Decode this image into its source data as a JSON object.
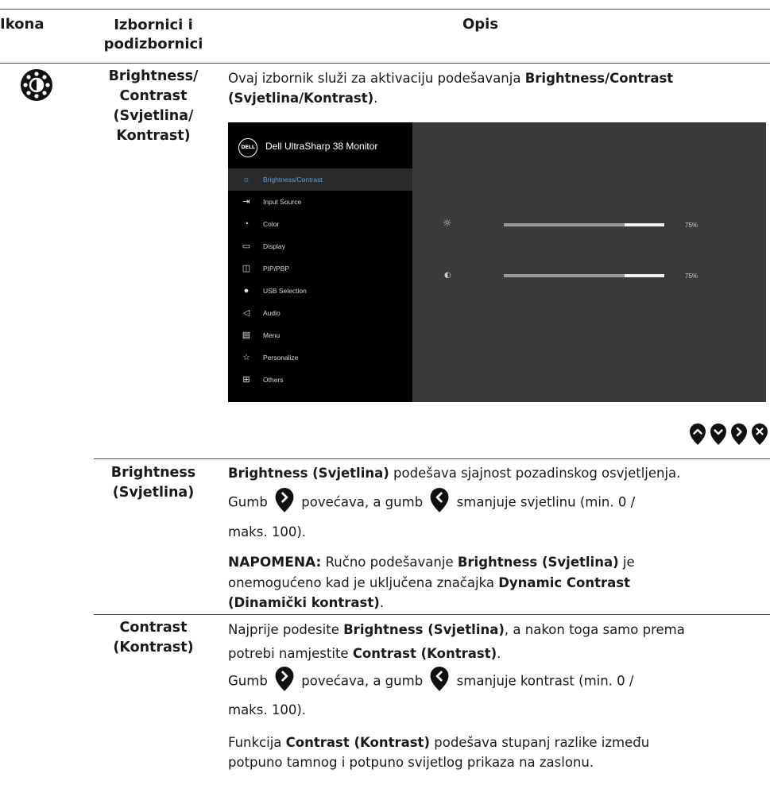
{
  "header": {
    "col_icon": "Ikona",
    "col_menus": "Izbornici i podizbornici",
    "col_desc": "Opis"
  },
  "section": {
    "icon_name": "brightness-contrast-icon",
    "title_line1": "Brightness/",
    "title_line2": "Contrast",
    "title_line3": "(Svjetlina/",
    "title_line4": "Kontrast)",
    "intro_pre": "Ovaj izbornik služi za aktivaciju podešavanja ",
    "intro_bold1": "Brightness/Contrast",
    "intro_bold2": "(Svjetlina/Kontrast)",
    "intro_post": "."
  },
  "osd": {
    "brand": "DELL",
    "title": "Dell UltraSharp 38 Monitor",
    "menu_items": [
      {
        "label": "Brightness/Contrast",
        "icon": "sun-icon"
      },
      {
        "label": "Input Source",
        "icon": "input-icon"
      },
      {
        "label": "Color",
        "icon": "color-icon"
      },
      {
        "label": "Display",
        "icon": "display-icon"
      },
      {
        "label": "PIP/PBP",
        "icon": "pip-icon"
      },
      {
        "label": "USB Selection",
        "icon": "usb-icon"
      },
      {
        "label": "Audio",
        "icon": "audio-icon"
      },
      {
        "label": "Menu",
        "icon": "menu-icon"
      },
      {
        "label": "Personalize",
        "icon": "star-icon"
      },
      {
        "label": "Others",
        "icon": "others-icon"
      }
    ],
    "brightness": {
      "value": 0.75,
      "label": "75%"
    },
    "contrast": {
      "value": 0.75,
      "label": "75%"
    }
  },
  "nav_buttons": [
    "up-icon",
    "down-icon",
    "right-icon",
    "close-icon"
  ],
  "brightness_row": {
    "title_line1": "Brightness",
    "title_line2": "(Svjetlina)",
    "p1_bold": "Brightness (Svjetlina)",
    "p1_rest": " podešava sjajnost pozadinskog osvjetljenja.",
    "p2_a": "Gumb",
    "p2_b": "povećava, a gumb",
    "p2_c": "smanjuje svjetlinu (min. 0 /",
    "p2_d": "maks. 100).",
    "note_label": "NAPOMENA:",
    "note_a": " Ručno podešavanje ",
    "note_bold1": "Brightness (Svjetlina)",
    "note_b": " je",
    "note_c": "onemogućeno kad je uključena značajka ",
    "note_bold2": "Dynamic Contrast",
    "note_bold3": "(Dinamički kontrast)",
    "note_end": "."
  },
  "contrast_row": {
    "title_line1": "Contrast",
    "title_line2": "(Kontrast)",
    "p1_a": "Najprije podesite ",
    "p1_bold1": "Brightness (Svjetlina)",
    "p1_b": ", a nakon toga samo prema",
    "p1_c": "potrebi namjestite ",
    "p1_bold2": "Contrast (Kontrast)",
    "p1_end": ".",
    "p2_a": "Gumb",
    "p2_b": "povećava, a gumb",
    "p2_c": "smanjuje kontrast (min. 0 /",
    "p2_d": "maks. 100).",
    "p3_a": "Funkcija ",
    "p3_bold": "Contrast (Kontrast)",
    "p3_b": " podešava stupanj razlike između",
    "p3_c": "potpuno tamnog i potpuno svijetlog prikaza na zaslonu."
  }
}
